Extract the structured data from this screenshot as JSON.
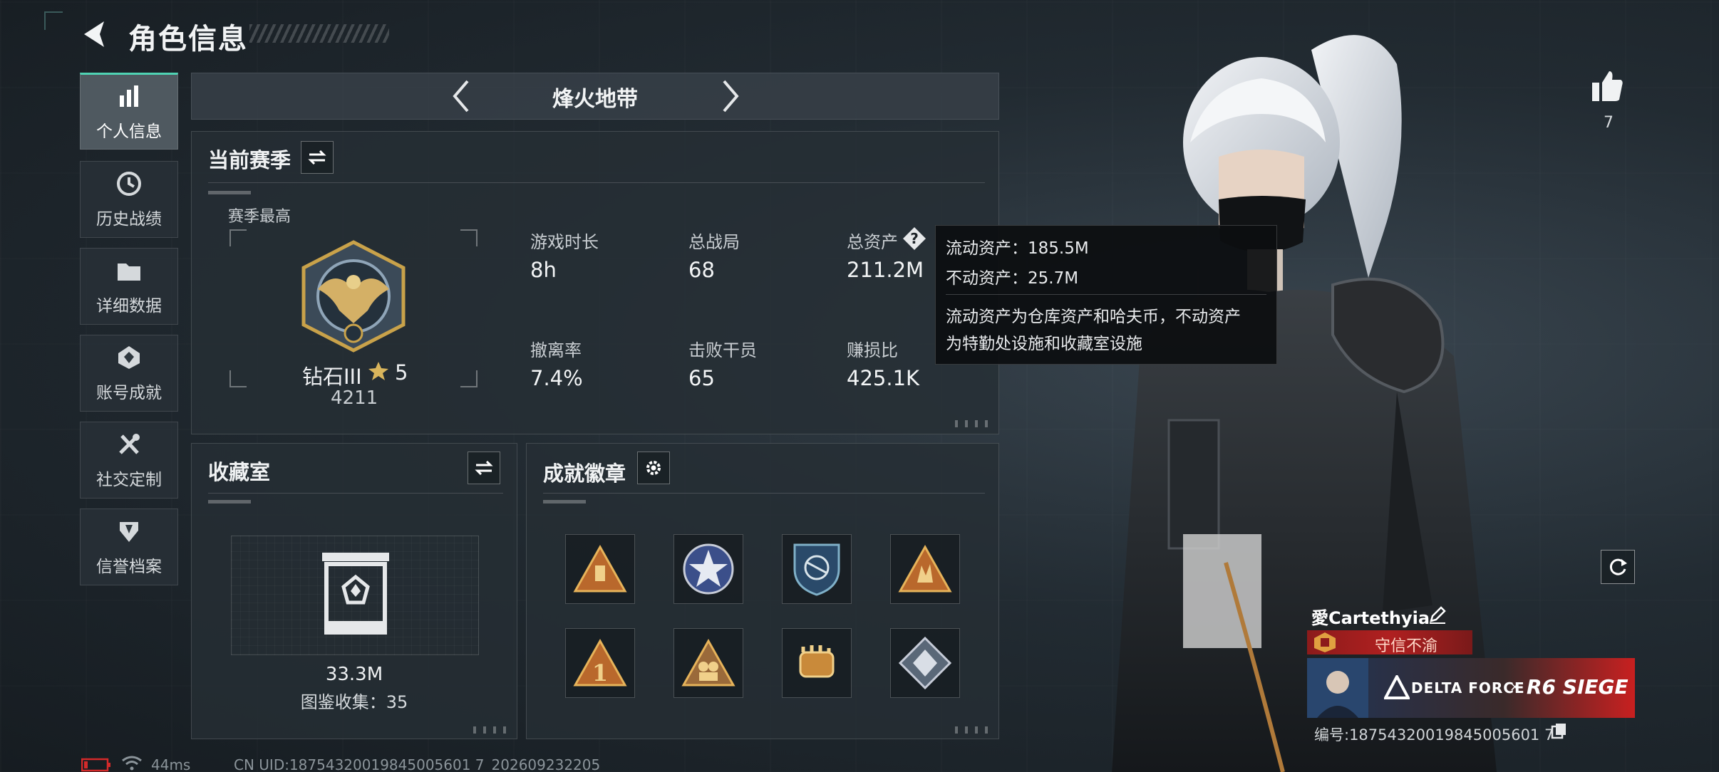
{
  "header": {
    "title": "角色信息"
  },
  "sidebar": {
    "items": [
      {
        "label": "个人信息",
        "icon": "bar-chart-icon",
        "active": true
      },
      {
        "label": "历史战绩",
        "icon": "clock-icon",
        "active": false
      },
      {
        "label": "详细数据",
        "icon": "folder-icon",
        "active": false
      },
      {
        "label": "账号成就",
        "icon": "achievement-icon",
        "active": false
      },
      {
        "label": "社交定制",
        "icon": "tools-icon",
        "active": false
      },
      {
        "label": "信誉档案",
        "icon": "shield-icon",
        "active": false
      }
    ]
  },
  "mode": {
    "name": "烽火地带"
  },
  "season": {
    "title": "当前赛季",
    "best_label": "赛季最高",
    "rank_name": "钻石III",
    "rank_stars": "5",
    "rank_points": "4211",
    "stats": [
      {
        "label": "游戏时长",
        "value": "8h"
      },
      {
        "label": "总战局",
        "value": "68"
      },
      {
        "label": "总资产",
        "value": "211.2M"
      },
      {
        "label": "撤离率",
        "value": "7.4%"
      },
      {
        "label": "击败干员",
        "value": "65"
      },
      {
        "label": "赚损比",
        "value": "425.1K"
      }
    ]
  },
  "tooltip": {
    "liquid": "流动资产：185.5M",
    "fixed": "不动资产：25.7M",
    "desc1": "流动资产为仓库资产和哈夫币，不动资产",
    "desc2": "为特勤处设施和收藏室设施"
  },
  "collection": {
    "title": "收藏室",
    "value": "33.3M",
    "collected": "图鉴收集：35"
  },
  "badges": {
    "title": "成就徽章",
    "items": [
      "badge-1",
      "badge-2",
      "badge-3",
      "badge-4",
      "badge-5",
      "badge-6",
      "badge-7",
      "badge-8"
    ]
  },
  "profile": {
    "likes": "7",
    "player_name": "愛Cartethyia",
    "reputation": "守信不渝",
    "banner_left": "DELTA FORCE",
    "banner_x": "×",
    "banner_right": "R6 SIEGE",
    "id_line": "编号:18754320019845005601 7"
  },
  "status": {
    "ping": "44ms",
    "uid": "CN UID:18754320019845005601 7_202609232205"
  },
  "colors": {
    "accent": "#4fd3b3",
    "reputation": "#b02020"
  }
}
